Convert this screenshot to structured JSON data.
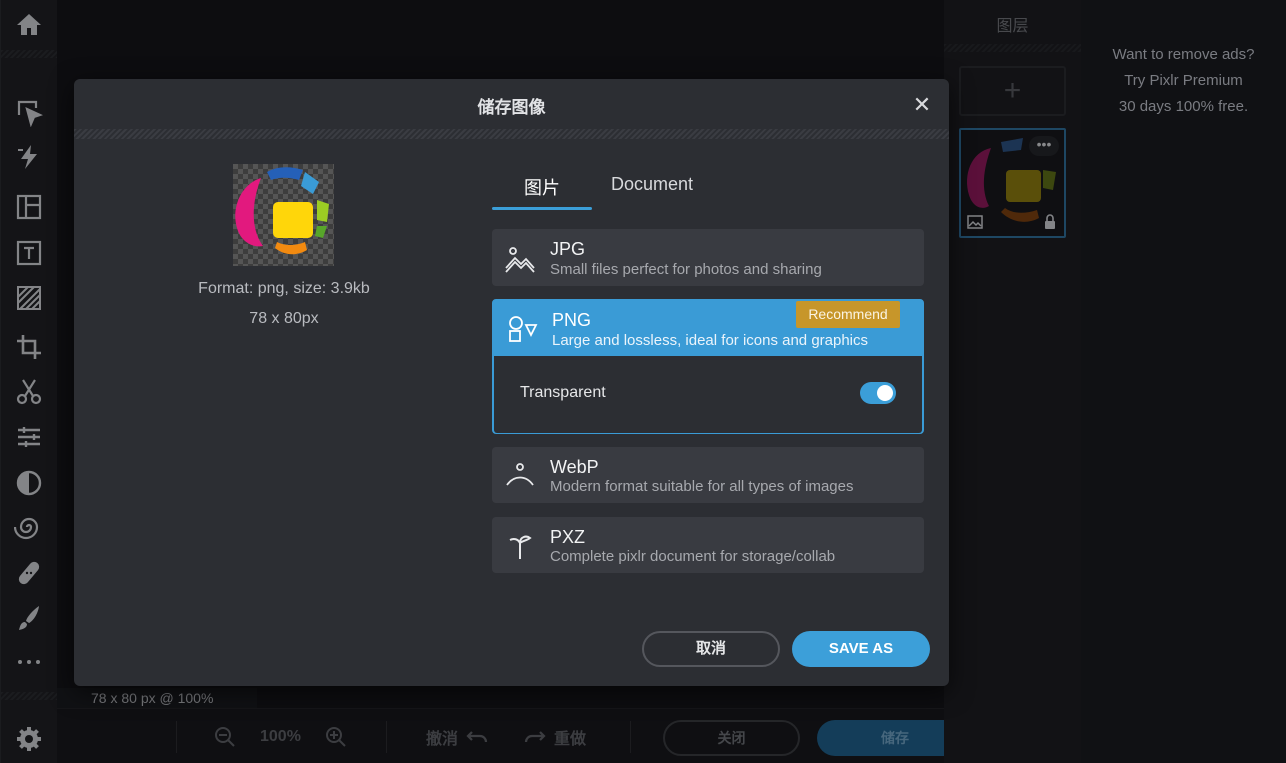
{
  "layers_panel": {
    "title": "图层",
    "add_label": "+"
  },
  "ad": {
    "line1": "Want to remove ads?",
    "line2": "Try Pixlr Premium",
    "line3": "30 days 100% free."
  },
  "status": {
    "text": "78 x 80 px @ 100%"
  },
  "bottombar": {
    "zoom": "100%",
    "undo_label": "撤消",
    "redo_label": "重做",
    "close_label": "关闭",
    "save_label": "储存"
  },
  "toolbar": {
    "tools": [
      "home-icon",
      "arrange-icon",
      "quick-select-icon",
      "layout-icon",
      "text-icon",
      "pattern-icon",
      "crop-icon",
      "cutout-icon",
      "adjust-icon",
      "filter-icon",
      "liquify-icon",
      "heal-icon",
      "brush-icon",
      "more-icon",
      "settings-icon"
    ]
  },
  "modal": {
    "title": "储存图像",
    "close_glyph": "✕",
    "preview_format": "Format: png, size: 3.9kb",
    "preview_dims": "78 x 80px",
    "tabs": [
      {
        "label": "图片",
        "active": true
      },
      {
        "label": "Document",
        "active": false
      }
    ],
    "options": [
      {
        "name": "JPG",
        "desc": "Small files perfect for photos and sharing",
        "icon": "landscape-icon"
      },
      {
        "name": "PNG",
        "desc": "Large and lossless, ideal for icons and graphics",
        "icon": "shapes-icon",
        "badge": "Recommend",
        "selected": true,
        "setting_label": "Transparent",
        "transparent": true
      },
      {
        "name": "WebP",
        "desc": "Modern format suitable for all types of images",
        "icon": "webp-icon"
      },
      {
        "name": "PXZ",
        "desc": "Complete pixlr document for storage/collab",
        "icon": "pixlr-icon"
      }
    ],
    "cancel_label": "取消",
    "saveas_label": "SAVE AS"
  },
  "colors": {
    "accent": "#3b9ed8",
    "badge": "#c7962a",
    "modal_bg": "#2c2e33",
    "option_bg": "#393b41"
  }
}
